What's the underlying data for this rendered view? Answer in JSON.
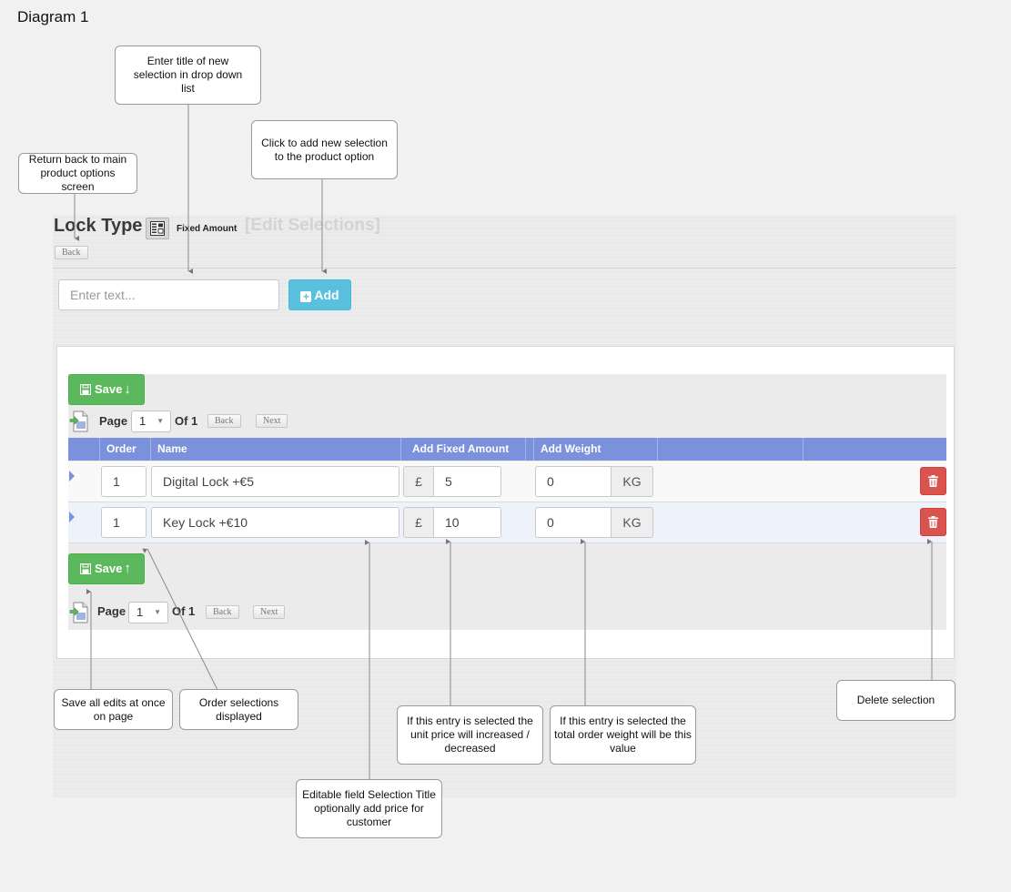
{
  "diagram_title": "Diagram 1",
  "header": {
    "title": "Lock Type",
    "type_icon": "list-settings-icon",
    "type_label": "Fixed Amount",
    "edit_selections": "[Edit Selections]",
    "back_label": "Back"
  },
  "new_selection": {
    "placeholder": "Enter text...",
    "add_label": "Add",
    "add_icon": "plus-square-icon"
  },
  "toolbar_top": {
    "save_label": "Save",
    "save_icon": "floppy-disk-icon",
    "arrow": "↓",
    "page_label": "Page",
    "page_value": "1",
    "of_label": "Of 1",
    "back_label": "Back",
    "next_label": "Next"
  },
  "toolbar_bottom": {
    "save_label": "Save",
    "save_icon": "floppy-disk-icon",
    "arrow": "↑",
    "page_label": "Page",
    "page_value": "1",
    "of_label": "Of 1",
    "back_label": "Back",
    "next_label": "Next"
  },
  "grid": {
    "columns": [
      "Order",
      "Name",
      "Add Fixed Amount",
      "Add  Weight"
    ],
    "rows": [
      {
        "order": "1",
        "name": "Digital Lock +€5",
        "currency": "£",
        "amount": "5",
        "weight": "0",
        "unit": "KG"
      },
      {
        "order": "1",
        "name": "Key Lock +€10",
        "currency": "£",
        "amount": "10",
        "weight": "0",
        "unit": "KG"
      }
    ]
  },
  "callouts": {
    "enter_title": "Enter title of new selection in drop down list",
    "click_add": "Click to add new selection to the product option",
    "return_back": "Return back to main product options screen",
    "save_all": "Save all edits at once on page",
    "order_displayed": "Order selections displayed",
    "unit_price": "If this entry is selected the unit price will increased / decreased",
    "order_weight": "If this entry is selected the total order weight will be this value",
    "delete_selection": "Delete selection",
    "editable_field": "Editable field Selection Title optionally add price for customer"
  },
  "colors": {
    "grid_header": "#7b91dc",
    "add_button": "#5bc0de",
    "save_button": "#5cb85c",
    "delete_button": "#d9534f"
  }
}
